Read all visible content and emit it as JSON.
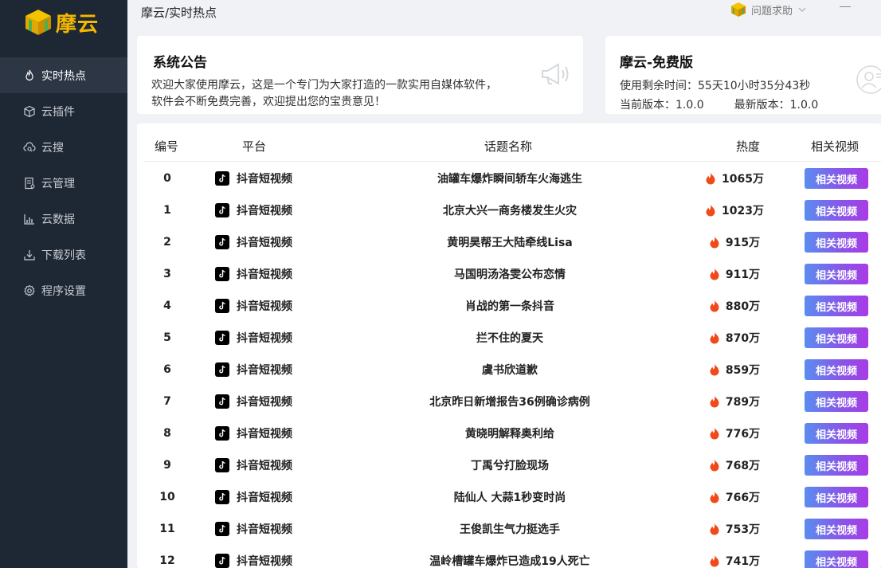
{
  "app": {
    "logo_text": "摩云"
  },
  "sidebar": {
    "items": [
      {
        "label": "实时热点",
        "icon": "flame-icon",
        "active": true
      },
      {
        "label": "云插件",
        "icon": "cube-icon",
        "active": false
      },
      {
        "label": "云搜",
        "icon": "cloud-search-icon",
        "active": false
      },
      {
        "label": "云管理",
        "icon": "document-manage-icon",
        "active": false
      },
      {
        "label": "云数据",
        "icon": "bar-chart-icon",
        "active": false
      },
      {
        "label": "下载列表",
        "icon": "download-icon",
        "active": false
      },
      {
        "label": "程序设置",
        "icon": "gear-icon",
        "active": false
      }
    ]
  },
  "header": {
    "breadcrumb": "摩云/实时热点",
    "help_label": "问题求助"
  },
  "notice": {
    "title": "系统公告",
    "body": "欢迎大家使用摩云，这是一个专门为大家打造的一款实用自媒体软件，软件会不断免费完善，欢迎提出您的宝贵意见！"
  },
  "version": {
    "title": "摩云-免费版",
    "remaining": "使用剩余时间：55天10小时35分43秒",
    "current": "当前版本：1.0.0",
    "latest": "最新版本：1.0.0"
  },
  "table": {
    "headers": {
      "num": "编号",
      "platform": "平台",
      "topic": "话题名称",
      "heat": "热度",
      "video": "相关视频"
    },
    "button_label": "相关视频",
    "rows": [
      {
        "num": "0",
        "platform": "抖音短视频",
        "topic": "油罐车爆炸瞬间轿车火海逃生",
        "heat": "1065万"
      },
      {
        "num": "1",
        "platform": "抖音短视频",
        "topic": "北京大兴一商务楼发生火灾",
        "heat": "1023万"
      },
      {
        "num": "2",
        "platform": "抖音短视频",
        "topic": "黄明昊帮王大陆牵线Lisa",
        "heat": "915万"
      },
      {
        "num": "3",
        "platform": "抖音短视频",
        "topic": "马国明汤洛雯公布恋情",
        "heat": "911万"
      },
      {
        "num": "4",
        "platform": "抖音短视频",
        "topic": "肖战的第一条抖音",
        "heat": "880万"
      },
      {
        "num": "5",
        "platform": "抖音短视频",
        "topic": "拦不住的夏天",
        "heat": "870万"
      },
      {
        "num": "6",
        "platform": "抖音短视频",
        "topic": "虞书欣道歉",
        "heat": "859万"
      },
      {
        "num": "7",
        "platform": "抖音短视频",
        "topic": "北京昨日新增报告36例确诊病例",
        "heat": "789万"
      },
      {
        "num": "8",
        "platform": "抖音短视频",
        "topic": "黄晓明解释奥利给",
        "heat": "776万"
      },
      {
        "num": "9",
        "platform": "抖音短视频",
        "topic": "丁禹兮打脸现场",
        "heat": "768万"
      },
      {
        "num": "10",
        "platform": "抖音短视频",
        "topic": "陆仙人 大蒜1秒变时尚",
        "heat": "766万"
      },
      {
        "num": "11",
        "platform": "抖音短视频",
        "topic": "王俊凯生气力挺选手",
        "heat": "753万"
      },
      {
        "num": "12",
        "platform": "抖音短视频",
        "topic": "温岭槽罐车爆炸已造成19人死亡",
        "heat": "741万"
      }
    ]
  },
  "colors": {
    "sidebar_bg": "#1e2734",
    "accent": "#f5b800",
    "flame": "#f04a1a",
    "button_start": "#5b8def",
    "button_end": "#a83be6"
  }
}
